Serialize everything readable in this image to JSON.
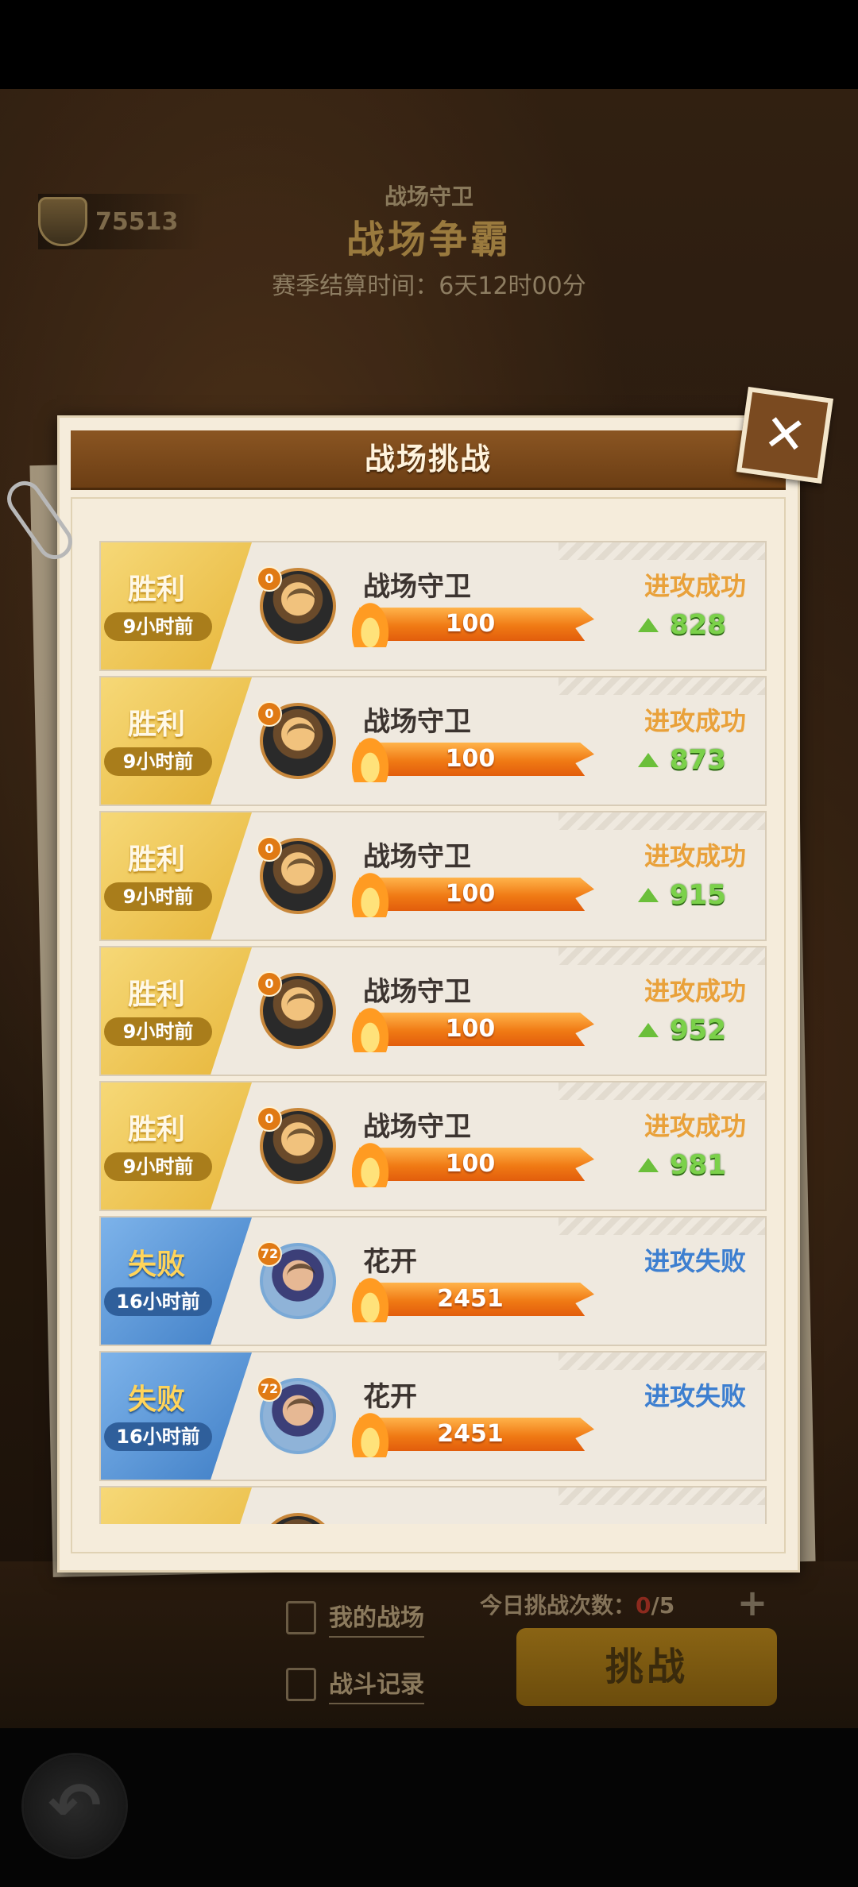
{
  "background": {
    "trophy_score": "75513",
    "title_small": "战场守卫",
    "title_big": "战场争霸",
    "season_text": "赛季结算时间：6天12时00分"
  },
  "bottom": {
    "my_battlefield": "我的战场",
    "battle_record": "战斗记录",
    "daily_challenges_label": "今日挑战次数：",
    "daily_challenges_used": "0",
    "daily_challenges_total": "/5",
    "plus_label": "+",
    "challenge_button": "挑战"
  },
  "modal": {
    "title": "战场挑战",
    "records": [
      {
        "result": "胜利",
        "time": "9小时前",
        "level": "0",
        "name": "战场守卫",
        "power": "100",
        "outcome": "进攻成功",
        "delta": "828",
        "type": "win",
        "avatar": "guard"
      },
      {
        "result": "胜利",
        "time": "9小时前",
        "level": "0",
        "name": "战场守卫",
        "power": "100",
        "outcome": "进攻成功",
        "delta": "873",
        "type": "win",
        "avatar": "guard"
      },
      {
        "result": "胜利",
        "time": "9小时前",
        "level": "0",
        "name": "战场守卫",
        "power": "100",
        "outcome": "进攻成功",
        "delta": "915",
        "type": "win",
        "avatar": "guard"
      },
      {
        "result": "胜利",
        "time": "9小时前",
        "level": "0",
        "name": "战场守卫",
        "power": "100",
        "outcome": "进攻成功",
        "delta": "952",
        "type": "win",
        "avatar": "guard"
      },
      {
        "result": "胜利",
        "time": "9小时前",
        "level": "0",
        "name": "战场守卫",
        "power": "100",
        "outcome": "进攻成功",
        "delta": "981",
        "type": "win",
        "avatar": "guard"
      },
      {
        "result": "失败",
        "time": "16小时前",
        "level": "72",
        "name": "花开",
        "power": "2451",
        "outcome": "进攻失败",
        "delta": "",
        "type": "lose",
        "avatar": "blue"
      },
      {
        "result": "失败",
        "time": "16小时前",
        "level": "72",
        "name": "花开",
        "power": "2451",
        "outcome": "进攻失败",
        "delta": "",
        "type": "lose",
        "avatar": "blue"
      },
      {
        "result": "",
        "time": "",
        "level": "",
        "name": "",
        "power": "",
        "outcome": "",
        "delta": "",
        "type": "win",
        "avatar": "guard"
      }
    ]
  },
  "colors": {
    "win_badge": "#e7b63a",
    "lose_badge": "#3e7dc5",
    "success_text": "#e9a13a",
    "fail_text": "#3d7fd0",
    "delta_green": "#7bd14a"
  }
}
